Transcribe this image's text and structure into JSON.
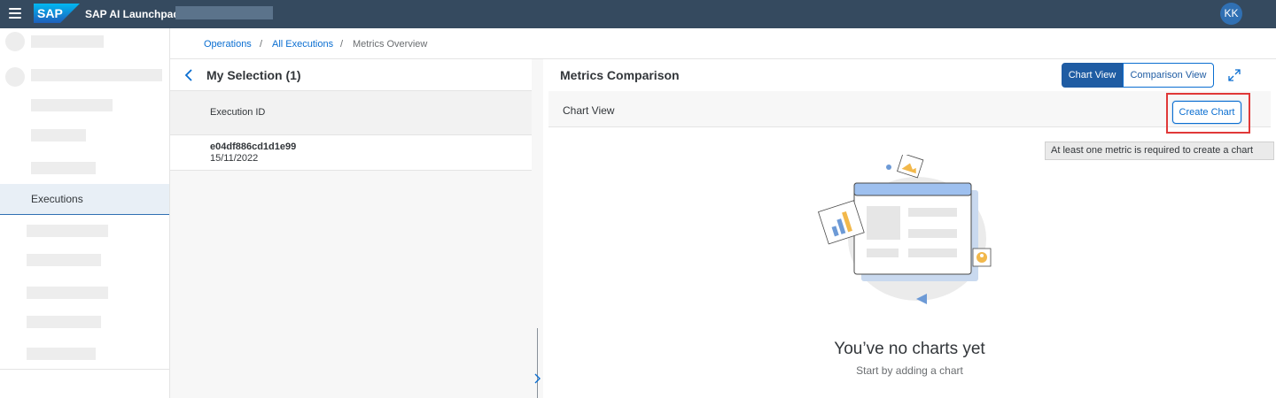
{
  "shell": {
    "logo_text": "SAP",
    "app_title": "SAP AI Launchpad",
    "user_initials": "KK",
    "colors": {
      "shell_bg": "#354a5f",
      "accent": "#0a6ed1"
    }
  },
  "sidebar": {
    "active_item": "Executions"
  },
  "breadcrumb": {
    "items": [
      "Operations",
      "All Executions",
      "Metrics Overview"
    ],
    "separator": "/"
  },
  "selection": {
    "title": "My Selection (1)",
    "column_header": "Execution ID",
    "rows": [
      {
        "id": "e04df886cd1d1e99",
        "date": "15/11/2022"
      }
    ]
  },
  "metrics": {
    "title": "Metrics Comparison",
    "tabs": [
      "Chart View",
      "Comparison View"
    ],
    "active_tab": "Chart View",
    "section_label": "Chart View",
    "create_button": "Create Chart",
    "tooltip": "At least one metric is required to create a chart",
    "empty_title": "You’ve no charts yet",
    "empty_subtitle": "Start by adding a chart"
  }
}
